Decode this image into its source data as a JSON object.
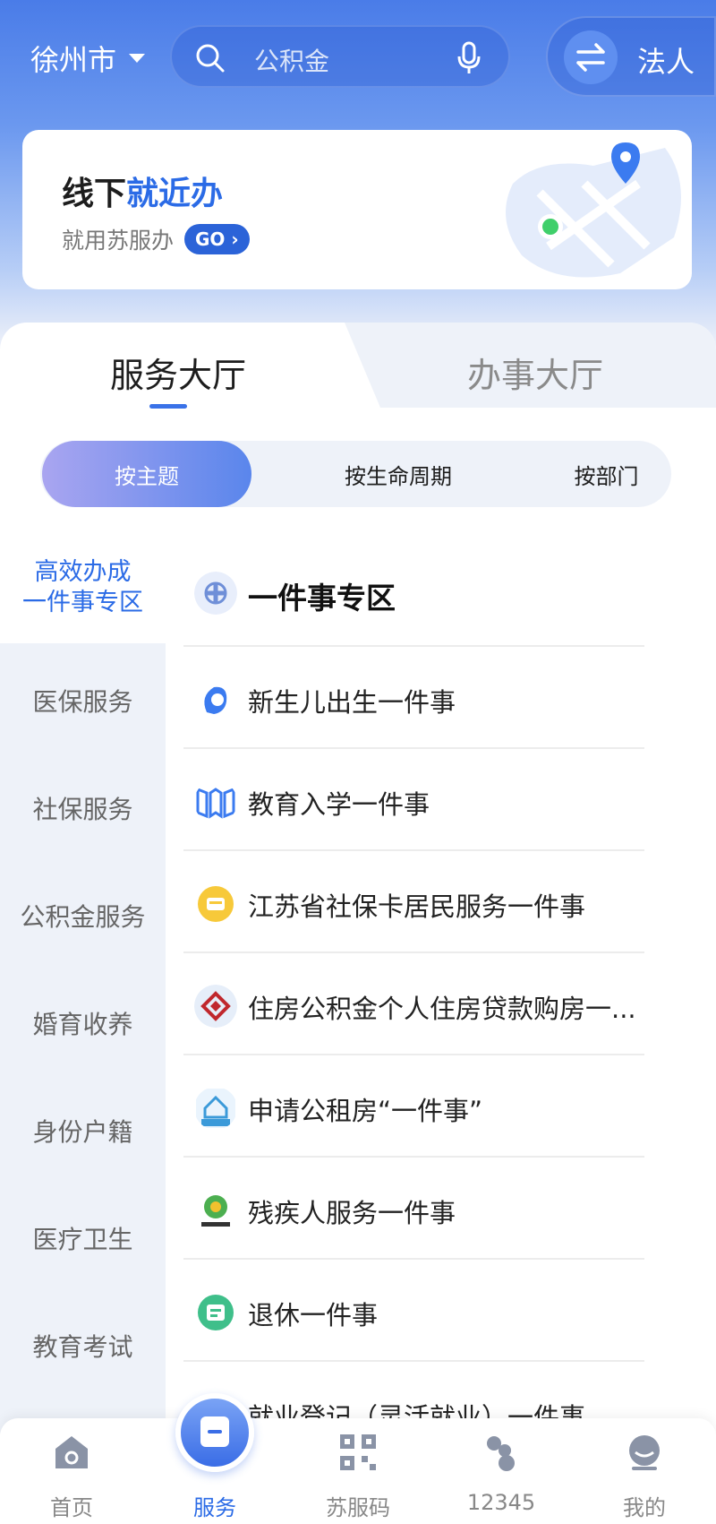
{
  "header": {
    "city": "徐州市",
    "search_placeholder": "公积金",
    "legal_label": "法人"
  },
  "banner": {
    "title_prefix": "线下",
    "title_highlight": "就近办",
    "subtitle": "就用苏服办",
    "go_label": "GO"
  },
  "tabs": {
    "service": "服务大厅",
    "affairs": "办事大厅"
  },
  "segments": {
    "by_theme": "按主题",
    "by_lifecycle": "按生命周期",
    "by_department": "按部门"
  },
  "left_nav": {
    "active_line1": "高效办成",
    "active_line2": "一件事专区",
    "items": [
      "医保服务",
      "社保服务",
      "公积金服务",
      "婚育收养",
      "身份户籍",
      "医疗卫生",
      "教育考试"
    ]
  },
  "list": {
    "header": "一件事专区",
    "items": [
      "新生儿出生一件事",
      "教育入学一件事",
      "江苏省社保卡居民服务一件事",
      "住房公积金个人住房贷款购房一...",
      "申请公租房“一件事”",
      "残疾人服务一件事",
      "退休一件事",
      "就业登记（灵活就业）一件事"
    ]
  },
  "bottom_tabs": {
    "home": "首页",
    "service": "服务",
    "code": "苏服码",
    "hotline": "12345",
    "mine": "我的"
  },
  "colors": {
    "brand_blue": "#2b6be6",
    "header_blue": "#4a7ce8"
  }
}
